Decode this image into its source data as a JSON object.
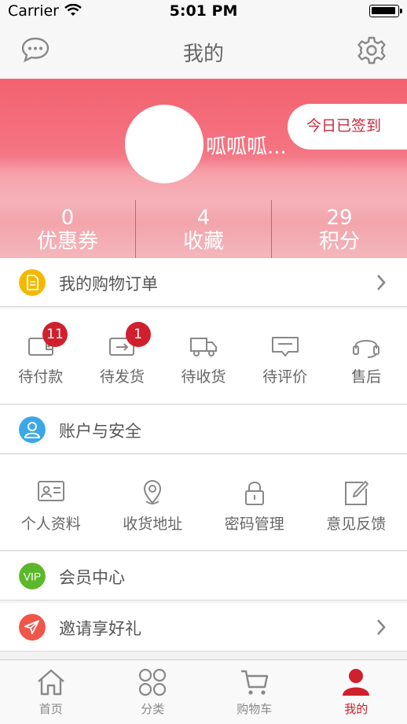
{
  "status_bar": {
    "carrier": "Carrier",
    "time": "5:01 PM"
  },
  "nav": {
    "title": "我的",
    "left_icon": "message-icon",
    "right_icon": "gear-icon"
  },
  "profile": {
    "username": "呱呱呱...",
    "signin_label": "今日已签到",
    "stats": [
      {
        "value": "0",
        "label": "优惠券"
      },
      {
        "value": "4",
        "label": "收藏"
      },
      {
        "value": "29",
        "label": "积分"
      }
    ]
  },
  "orders": {
    "title": "我的购物订单",
    "icon": "document-icon",
    "icon_color": "#f5b800",
    "items": [
      {
        "label": "待付款",
        "icon": "wallet-icon",
        "badge": "11"
      },
      {
        "label": "待发货",
        "icon": "card-send-icon",
        "badge": "1"
      },
      {
        "label": "待收货",
        "icon": "truck-icon",
        "badge": ""
      },
      {
        "label": "待评价",
        "icon": "comment-icon",
        "badge": ""
      },
      {
        "label": "售后",
        "icon": "headset-icon",
        "badge": ""
      }
    ]
  },
  "account": {
    "title": "账户与安全",
    "icon": "user-icon",
    "icon_color": "#3aa8e8",
    "items": [
      {
        "label": "个人资料",
        "icon": "id-card-icon"
      },
      {
        "label": "收货地址",
        "icon": "location-pin-icon"
      },
      {
        "label": "密码管理",
        "icon": "lock-icon"
      },
      {
        "label": "意见反馈",
        "icon": "edit-icon"
      }
    ]
  },
  "vip": {
    "title": "会员中心",
    "badge_text": "VIP",
    "icon_color": "#5cb82a"
  },
  "invite": {
    "title": "邀请享好礼",
    "icon": "paper-plane-icon",
    "icon_color": "#f0564a"
  },
  "tabs": [
    {
      "label": "首页",
      "icon": "home-icon"
    },
    {
      "label": "分类",
      "icon": "grid-icon"
    },
    {
      "label": "购物车",
      "icon": "cart-icon"
    },
    {
      "label": "我的",
      "icon": "user-icon",
      "active": true
    }
  ],
  "colors": {
    "accent": "#d0202e",
    "header_top": "#f3616f"
  }
}
